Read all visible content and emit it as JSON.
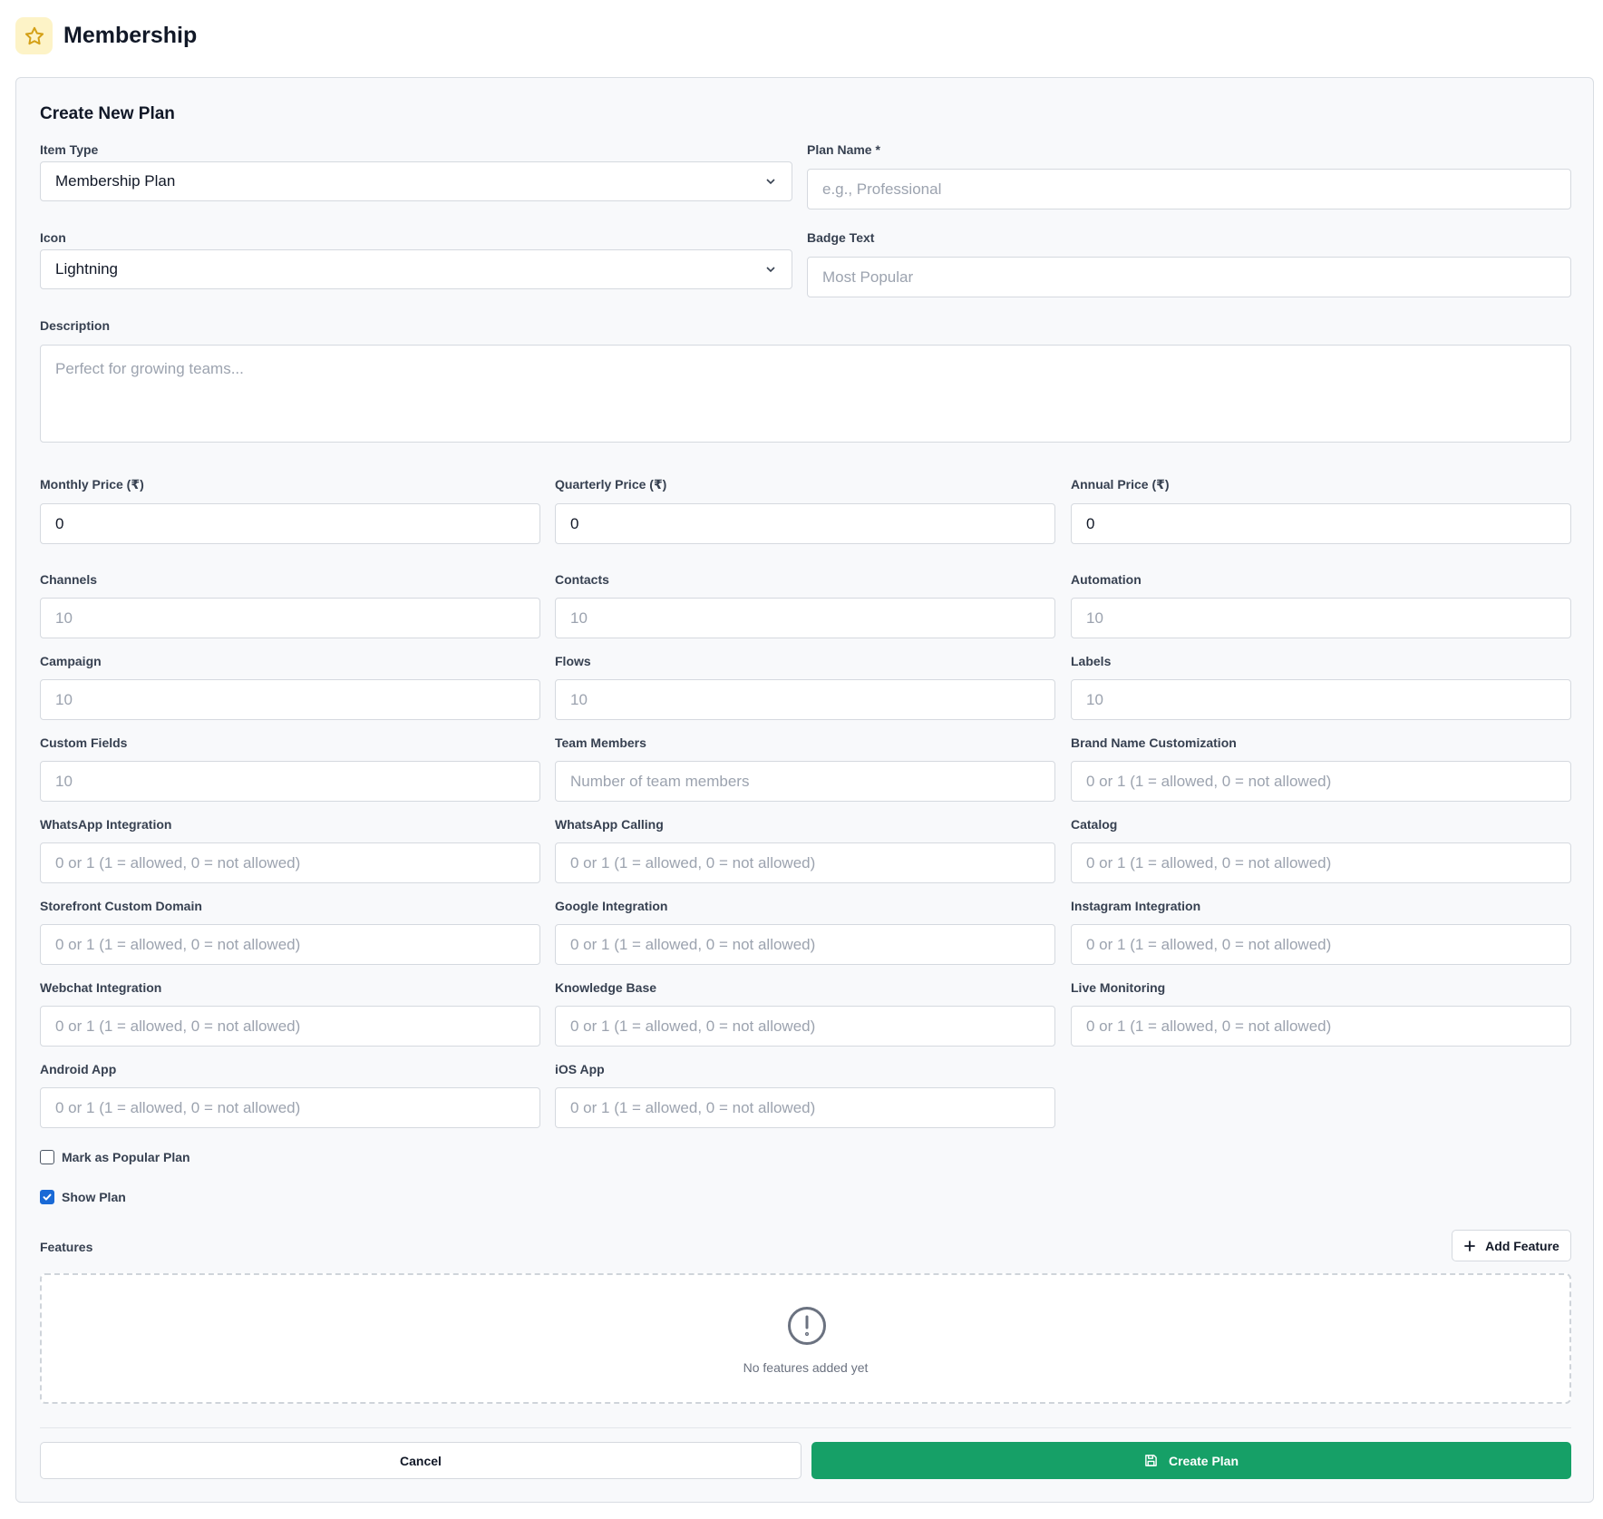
{
  "header": {
    "title": "Membership",
    "icon": "star-icon"
  },
  "form": {
    "title": "Create New Plan",
    "item_type": {
      "label": "Item Type",
      "value": "Membership Plan"
    },
    "plan_name": {
      "label": "Plan Name *",
      "value": "",
      "placeholder": "e.g., Professional"
    },
    "icon": {
      "label": "Icon",
      "value": "Lightning"
    },
    "badge_text": {
      "label": "Badge Text",
      "value": "",
      "placeholder": "Most Popular"
    },
    "description": {
      "label": "Description",
      "value": "",
      "placeholder": "Perfect for growing teams..."
    },
    "monthly_price": {
      "label": "Monthly Price (₹)",
      "value": "0"
    },
    "quarterly_price": {
      "label": "Quarterly Price (₹)",
      "value": "0"
    },
    "annual_price": {
      "label": "Annual Price (₹)",
      "value": "0"
    },
    "channels": {
      "label": "Channels",
      "placeholder": "10"
    },
    "contacts": {
      "label": "Contacts",
      "placeholder": "10"
    },
    "automation": {
      "label": "Automation",
      "placeholder": "10"
    },
    "campaign": {
      "label": "Campaign",
      "placeholder": "10"
    },
    "flows": {
      "label": "Flows",
      "placeholder": "10"
    },
    "labels": {
      "label": "Labels",
      "placeholder": "10"
    },
    "custom_fields": {
      "label": "Custom Fields",
      "placeholder": "10"
    },
    "team_members": {
      "label": "Team Members",
      "placeholder": "Number of team members"
    },
    "brand_name_customization": {
      "label": "Brand Name Customization",
      "placeholder": "0 or 1 (1 = allowed, 0 = not allowed)"
    },
    "whatsapp_integration": {
      "label": "WhatsApp Integration",
      "placeholder": "0 or 1 (1 = allowed, 0 = not allowed)"
    },
    "whatsapp_calling": {
      "label": "WhatsApp Calling",
      "placeholder": "0 or 1 (1 = allowed, 0 = not allowed)"
    },
    "catalog": {
      "label": "Catalog",
      "placeholder": "0 or 1 (1 = allowed, 0 = not allowed)"
    },
    "storefront_custom_domain": {
      "label": "Storefront Custom Domain",
      "placeholder": "0 or 1 (1 = allowed, 0 = not allowed)"
    },
    "google_integration": {
      "label": "Google Integration",
      "placeholder": "0 or 1 (1 = allowed, 0 = not allowed)"
    },
    "instagram_integration": {
      "label": "Instagram Integration",
      "placeholder": "0 or 1 (1 = allowed, 0 = not allowed)"
    },
    "webchat_integration": {
      "label": "Webchat Integration",
      "placeholder": "0 or 1 (1 = allowed, 0 = not allowed)"
    },
    "knowledge_base": {
      "label": "Knowledge Base",
      "placeholder": "0 or 1 (1 = allowed, 0 = not allowed)"
    },
    "live_monitoring": {
      "label": "Live Monitoring",
      "placeholder": "0 or 1 (1 = allowed, 0 = not allowed)"
    },
    "android_app": {
      "label": "Android App",
      "placeholder": "0 or 1 (1 = allowed, 0 = not allowed)"
    },
    "ios_app": {
      "label": "iOS App",
      "placeholder": "0 or 1 (1 = allowed, 0 = not allowed)"
    },
    "mark_popular": {
      "label": "Mark as Popular Plan",
      "checked": false
    },
    "show_plan": {
      "label": "Show Plan",
      "checked": true
    },
    "features": {
      "label": "Features",
      "add_button": "Add Feature",
      "empty_text": "No features added yet"
    },
    "cancel_button": "Cancel",
    "create_button": "Create Plan"
  },
  "colors": {
    "primary_green": "#16a067",
    "checkbox_blue": "#1a6ad6",
    "star_gold": "#d4a017",
    "header_icon_bg": "#fdf3c7"
  }
}
